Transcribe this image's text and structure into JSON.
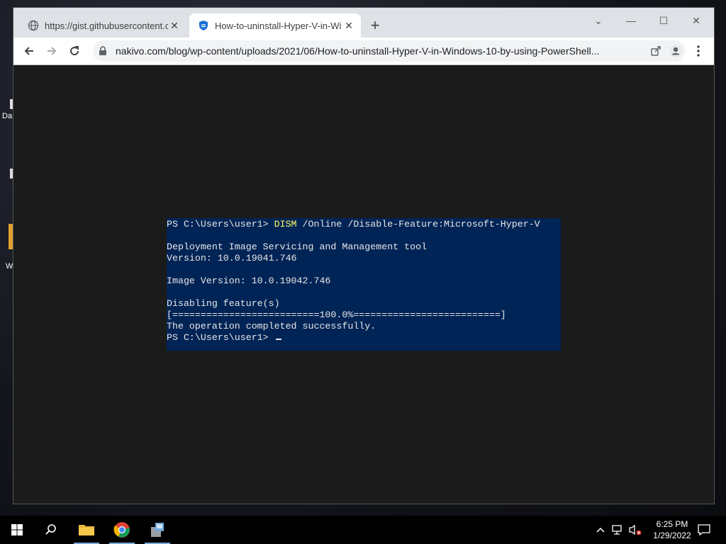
{
  "desktop": {
    "icons": [
      {
        "label": "Da"
      },
      {
        "label": "W"
      }
    ]
  },
  "browser": {
    "tabs": [
      {
        "title": "https://gist.githubusercontent.com",
        "active": false,
        "favicon": "globe-icon"
      },
      {
        "title": "How-to-uninstall-Hyper-V-in-Wi",
        "active": true,
        "favicon": "shield-icon"
      }
    ],
    "new_tab": "+",
    "window_controls": {
      "tab_search": "⌄",
      "minimize": "—",
      "maximize": "☐",
      "close": "✕"
    },
    "url": "nakivo.com/blog/wp-content/uploads/2021/06/How-to-uninstall-Hyper-V-in-Windows-10-by-using-PowerShell..."
  },
  "console": {
    "lines": [
      {
        "prompt": "PS C:\\Users\\user1> ",
        "command": "DISM",
        "rest": " /Online /Disable-Feature:Microsoft-Hyper-V"
      },
      {
        "text": ""
      },
      {
        "text": "Deployment Image Servicing and Management tool"
      },
      {
        "text": "Version: 10.0.19041.746"
      },
      {
        "text": ""
      },
      {
        "text": "Image Version: 10.0.19042.746"
      },
      {
        "text": ""
      },
      {
        "text": "Disabling feature(s)"
      },
      {
        "text": "[==========================100.0%==========================]"
      },
      {
        "text": "The operation completed successfully."
      },
      {
        "prompt": "PS C:\\Users\\user1> ",
        "cursor": true
      }
    ],
    "colors": {
      "background": "#012456",
      "text": "#e6e6e6",
      "command": "#ffff66"
    }
  },
  "taskbar": {
    "time": "6:25 PM",
    "date": "1/29/2022",
    "items": [
      "start-icon",
      "search-icon",
      "file-explorer-icon",
      "chrome-icon",
      "installer-icon"
    ]
  }
}
